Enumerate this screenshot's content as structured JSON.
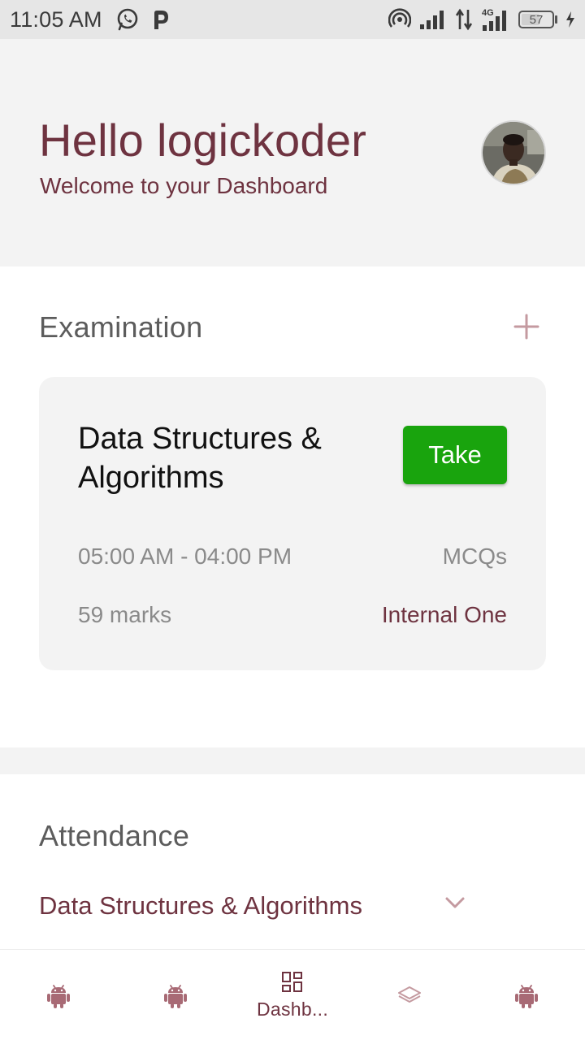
{
  "status_bar": {
    "time": "11:05 AM",
    "battery": "57",
    "network": "4G",
    "left_icons": [
      "whatsapp-icon",
      "p-icon"
    ],
    "right_icons": [
      "hotspot-icon",
      "signal-icon",
      "data-transfer-icon",
      "signal-4g-icon",
      "battery-icon",
      "charging-icon"
    ]
  },
  "header": {
    "greeting": "Hello logickoder",
    "subtitle": "Welcome to your Dashboard"
  },
  "examination": {
    "title": "Examination",
    "add_icon": "plus-icon",
    "card": {
      "course": "Data Structures & Algorithms",
      "action_label": "Take",
      "time_range": "05:00 AM - 04:00 PM",
      "type": "MCQs",
      "marks": "59 marks",
      "category": "Internal One"
    }
  },
  "attendance": {
    "title": "Attendance",
    "selected_course": "Data Structures & Algorithms"
  },
  "bottom_nav": {
    "items": [
      {
        "icon": "android-icon",
        "label": ""
      },
      {
        "icon": "android-icon",
        "label": ""
      },
      {
        "icon": "dashboard-icon",
        "label": "Dashb..."
      },
      {
        "icon": "layers-icon",
        "label": ""
      },
      {
        "icon": "android-icon",
        "label": ""
      }
    ]
  },
  "colors": {
    "accent": "#6e3340",
    "accent_light": "#c49aa0",
    "take_button": "#19a40d",
    "card_bg": "#f3f3f3",
    "status_bar_bg": "#e6e6e6"
  }
}
